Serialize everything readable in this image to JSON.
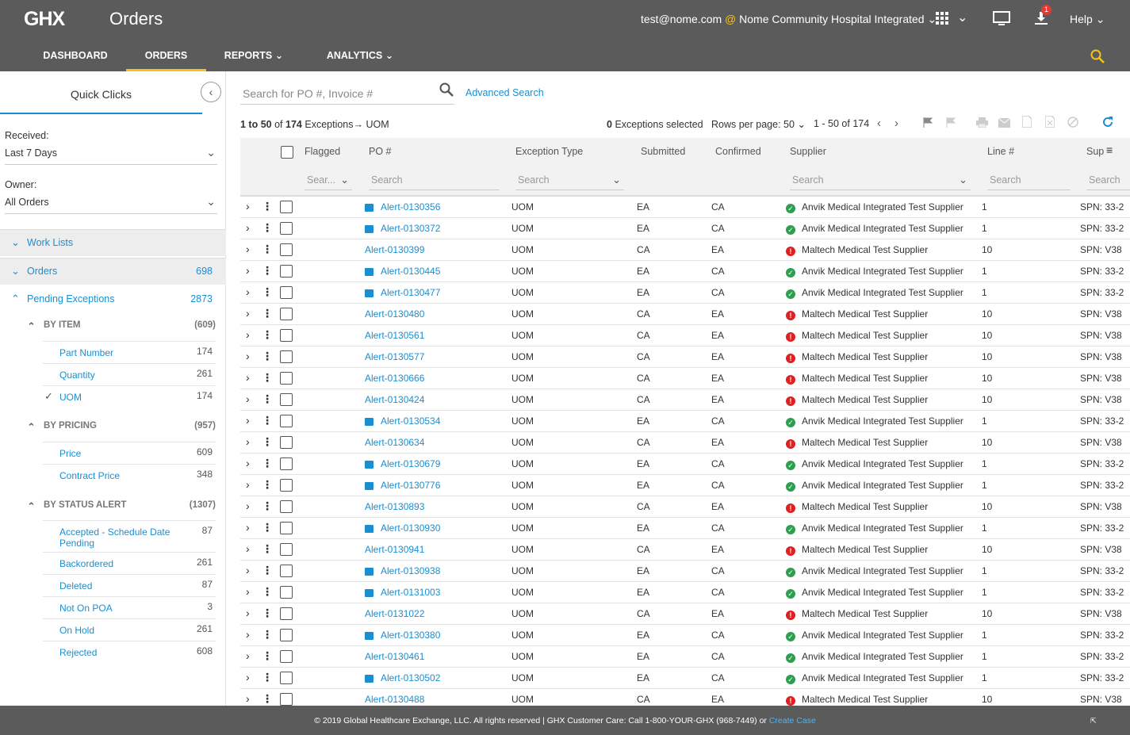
{
  "header": {
    "logo_text": "GHX",
    "title": "Orders",
    "user": "test@nome.com",
    "org_at": "@",
    "org": "Nome Community Hospital Integrated",
    "download_badge": "1",
    "help": "Help"
  },
  "nav": [
    {
      "label": "DASHBOARD"
    },
    {
      "label": "ORDERS",
      "active": true
    },
    {
      "label": "REPORTS"
    },
    {
      "label": "ANALYTICS"
    }
  ],
  "sidebar": {
    "title": "Quick Clicks",
    "received_label": "Received:",
    "received_value": "Last 7 Days",
    "owner_label": "Owner:",
    "owner_value": "All Orders",
    "work_lists": "Work Lists",
    "orders": {
      "label": "Orders",
      "count": "698"
    },
    "pending": {
      "label": "Pending Exceptions",
      "count": "2873"
    },
    "groups": [
      {
        "label": "BY ITEM",
        "count": "(609)",
        "items": [
          {
            "label": "Part Number",
            "count": "174"
          },
          {
            "label": "Quantity",
            "count": "261"
          },
          {
            "label": "UOM",
            "count": "174",
            "checked": true
          }
        ]
      },
      {
        "label": "BY PRICING",
        "count": "(957)",
        "items": [
          {
            "label": "Price",
            "count": "609"
          },
          {
            "label": "Contract Price",
            "count": "348"
          }
        ]
      },
      {
        "label": "BY STATUS ALERT",
        "count": "(1307)",
        "items": [
          {
            "label": "Accepted - Schedule Date Pending",
            "count": "87"
          },
          {
            "label": "Backordered",
            "count": "261"
          },
          {
            "label": "Deleted",
            "count": "87"
          },
          {
            "label": "Not On POA",
            "count": "3"
          },
          {
            "label": "On Hold",
            "count": "261"
          },
          {
            "label": "Rejected",
            "count": "608"
          }
        ]
      }
    ]
  },
  "toolbar": {
    "search_placeholder": "Search for PO #, Invoice #",
    "advanced_search": "Advanced Search",
    "breadcrumb_range": "1 to 50",
    "breadcrumb_of": "of",
    "breadcrumb_total": "174",
    "breadcrumb_label": "Exceptions",
    "breadcrumb_arrow": "→",
    "breadcrumb_filter": "UOM",
    "selected_count": "0",
    "selected_label": "Exceptions selected",
    "rows_per_page_label": "Rows per page:",
    "rows_per_page_value": "50",
    "pager": "1 - 50 of 174"
  },
  "table": {
    "headers": {
      "flagged": "Flagged",
      "po": "PO #",
      "exception_type": "Exception Type",
      "submitted": "Submitted",
      "confirmed": "Confirmed",
      "supplier": "Supplier",
      "line": "Line #",
      "sup": "Sup"
    },
    "filters": {
      "flagged": "Sear...",
      "po": "Search",
      "exception_type": "Search",
      "supplier": "Search",
      "line": "Search",
      "sup": "Search"
    },
    "status_colors": {
      "ok": "#2e9e4f",
      "alert": "#e02020"
    },
    "rows": [
      {
        "po": "Alert-0130356",
        "note": true,
        "type": "UOM",
        "submitted": "EA",
        "confirmed": "CA",
        "status": "ok",
        "supplier": "Anvik Medical Integrated Test Supplier",
        "line": "1",
        "sup": "SPN: 33-2"
      },
      {
        "po": "Alert-0130372",
        "note": true,
        "type": "UOM",
        "submitted": "EA",
        "confirmed": "CA",
        "status": "ok",
        "supplier": "Anvik Medical Integrated Test Supplier",
        "line": "1",
        "sup": "SPN: 33-2"
      },
      {
        "po": "Alert-0130399",
        "note": false,
        "type": "UOM",
        "submitted": "CA",
        "confirmed": "EA",
        "status": "alert",
        "supplier": "Maltech Medical Test Supplier",
        "line": "10",
        "sup": "SPN: V38"
      },
      {
        "po": "Alert-0130445",
        "note": true,
        "type": "UOM",
        "submitted": "EA",
        "confirmed": "CA",
        "status": "ok",
        "supplier": "Anvik Medical Integrated Test Supplier",
        "line": "1",
        "sup": "SPN: 33-2"
      },
      {
        "po": "Alert-0130477",
        "note": true,
        "type": "UOM",
        "submitted": "EA",
        "confirmed": "CA",
        "status": "ok",
        "supplier": "Anvik Medical Integrated Test Supplier",
        "line": "1",
        "sup": "SPN: 33-2"
      },
      {
        "po": "Alert-0130480",
        "note": false,
        "type": "UOM",
        "submitted": "CA",
        "confirmed": "EA",
        "status": "alert",
        "supplier": "Maltech Medical Test Supplier",
        "line": "10",
        "sup": "SPN: V38"
      },
      {
        "po": "Alert-0130561",
        "note": false,
        "type": "UOM",
        "submitted": "CA",
        "confirmed": "EA",
        "status": "alert",
        "supplier": "Maltech Medical Test Supplier",
        "line": "10",
        "sup": "SPN: V38"
      },
      {
        "po": "Alert-0130577",
        "note": false,
        "type": "UOM",
        "submitted": "CA",
        "confirmed": "EA",
        "status": "alert",
        "supplier": "Maltech Medical Test Supplier",
        "line": "10",
        "sup": "SPN: V38"
      },
      {
        "po": "Alert-0130666",
        "note": false,
        "type": "UOM",
        "submitted": "CA",
        "confirmed": "EA",
        "status": "alert",
        "supplier": "Maltech Medical Test Supplier",
        "line": "10",
        "sup": "SPN: V38"
      },
      {
        "po": "Alert-0130424",
        "note": false,
        "type": "UOM",
        "submitted": "CA",
        "confirmed": "EA",
        "status": "alert",
        "supplier": "Maltech Medical Test Supplier",
        "line": "10",
        "sup": "SPN: V38"
      },
      {
        "po": "Alert-0130534",
        "note": true,
        "type": "UOM",
        "submitted": "EA",
        "confirmed": "CA",
        "status": "ok",
        "supplier": "Anvik Medical Integrated Test Supplier",
        "line": "1",
        "sup": "SPN: 33-2"
      },
      {
        "po": "Alert-0130634",
        "note": false,
        "type": "UOM",
        "submitted": "CA",
        "confirmed": "EA",
        "status": "alert",
        "supplier": "Maltech Medical Test Supplier",
        "line": "10",
        "sup": "SPN: V38"
      },
      {
        "po": "Alert-0130679",
        "note": true,
        "type": "UOM",
        "submitted": "EA",
        "confirmed": "CA",
        "status": "ok",
        "supplier": "Anvik Medical Integrated Test Supplier",
        "line": "1",
        "sup": "SPN: 33-2"
      },
      {
        "po": "Alert-0130776",
        "note": true,
        "type": "UOM",
        "submitted": "EA",
        "confirmed": "CA",
        "status": "ok",
        "supplier": "Anvik Medical Integrated Test Supplier",
        "line": "1",
        "sup": "SPN: 33-2"
      },
      {
        "po": "Alert-0130893",
        "note": false,
        "type": "UOM",
        "submitted": "CA",
        "confirmed": "EA",
        "status": "alert",
        "supplier": "Maltech Medical Test Supplier",
        "line": "10",
        "sup": "SPN: V38"
      },
      {
        "po": "Alert-0130930",
        "note": true,
        "type": "UOM",
        "submitted": "EA",
        "confirmed": "CA",
        "status": "ok",
        "supplier": "Anvik Medical Integrated Test Supplier",
        "line": "1",
        "sup": "SPN: 33-2"
      },
      {
        "po": "Alert-0130941",
        "note": false,
        "type": "UOM",
        "submitted": "CA",
        "confirmed": "EA",
        "status": "alert",
        "supplier": "Maltech Medical Test Supplier",
        "line": "10",
        "sup": "SPN: V38"
      },
      {
        "po": "Alert-0130938",
        "note": true,
        "type": "UOM",
        "submitted": "EA",
        "confirmed": "CA",
        "status": "ok",
        "supplier": "Anvik Medical Integrated Test Supplier",
        "line": "1",
        "sup": "SPN: 33-2"
      },
      {
        "po": "Alert-0131003",
        "note": true,
        "type": "UOM",
        "submitted": "EA",
        "confirmed": "CA",
        "status": "ok",
        "supplier": "Anvik Medical Integrated Test Supplier",
        "line": "1",
        "sup": "SPN: 33-2"
      },
      {
        "po": "Alert-0131022",
        "note": false,
        "type": "UOM",
        "submitted": "CA",
        "confirmed": "EA",
        "status": "alert",
        "supplier": "Maltech Medical Test Supplier",
        "line": "10",
        "sup": "SPN: V38"
      },
      {
        "po": "Alert-0130380",
        "note": true,
        "type": "UOM",
        "submitted": "EA",
        "confirmed": "CA",
        "status": "ok",
        "supplier": "Anvik Medical Integrated Test Supplier",
        "line": "1",
        "sup": "SPN: 33-2"
      },
      {
        "po": "Alert-0130461",
        "note": false,
        "type": "UOM",
        "submitted": "EA",
        "confirmed": "CA",
        "status": "ok",
        "supplier": "Anvik Medical Integrated Test Supplier",
        "line": "1",
        "sup": "SPN: 33-2"
      },
      {
        "po": "Alert-0130502",
        "note": true,
        "type": "UOM",
        "submitted": "EA",
        "confirmed": "CA",
        "status": "ok",
        "supplier": "Anvik Medical Integrated Test Supplier",
        "line": "1",
        "sup": "SPN: 33-2"
      },
      {
        "po": "Alert-0130488",
        "note": false,
        "type": "UOM",
        "submitted": "CA",
        "confirmed": "EA",
        "status": "alert",
        "supplier": "Maltech Medical Test Supplier",
        "line": "10",
        "sup": "SPN: V38"
      }
    ]
  },
  "footer": {
    "text": "© 2019 Global Healthcare Exchange, LLC. All rights reserved | GHX Customer Care: Call 1-800-YOUR-GHX (968-7449) or",
    "link": "Create Case"
  }
}
